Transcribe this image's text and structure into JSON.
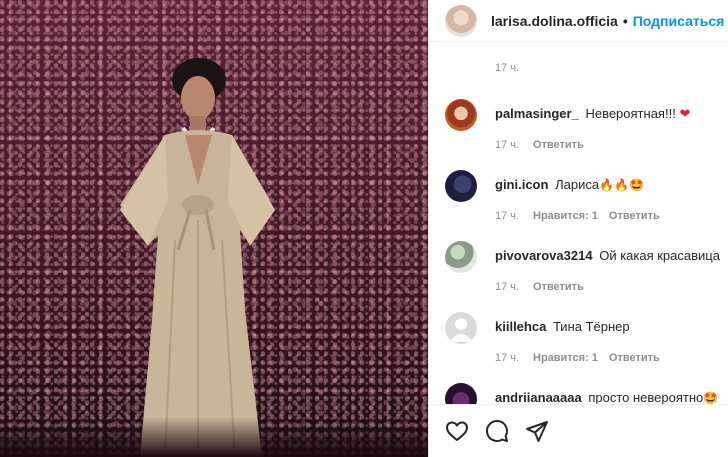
{
  "post": {
    "username": "larisa.dolina.officia",
    "separator": "•",
    "follow_label": "Подписаться"
  },
  "comments_top_time": "17 ч.",
  "comments": [
    {
      "username": "palmasinger_",
      "text": "Невероятная!!!",
      "emoji": "❤",
      "time": "17 ч.",
      "likes": "",
      "reply": "Ответить",
      "avatar": "avatar-photo"
    },
    {
      "username": "gini.icon",
      "text": "Лариса",
      "emoji": "🔥🔥🤩",
      "time": "17 ч.",
      "likes": "Нравится: 1",
      "reply": "Ответить",
      "avatar": "avatar-photo"
    },
    {
      "username": "pivovarova3214",
      "text": "Ой какая красавица",
      "emoji": "",
      "time": "17 ч.",
      "likes": "",
      "reply": "Ответить",
      "avatar": "avatar-photo"
    },
    {
      "username": "kiillehca",
      "text": "Тина Тёрнер",
      "emoji": "",
      "time": "17 ч.",
      "likes": "Нравится: 1",
      "reply": "Ответить",
      "avatar": "default-avatar"
    },
    {
      "username": "andriianaaaaa",
      "text": "просто невероятно",
      "emoji": "🤩",
      "time": "",
      "likes": "",
      "reply": "",
      "avatar": "avatar-photo"
    }
  ],
  "icons": {
    "like": "heart-outline-icon",
    "comment": "speech-bubble-icon",
    "share": "paper-plane-icon"
  },
  "colors": {
    "accent": "#0095f6",
    "text": "#262626",
    "muted": "#8e8e8e",
    "border": "#efefef",
    "heart": "#d7263d"
  }
}
